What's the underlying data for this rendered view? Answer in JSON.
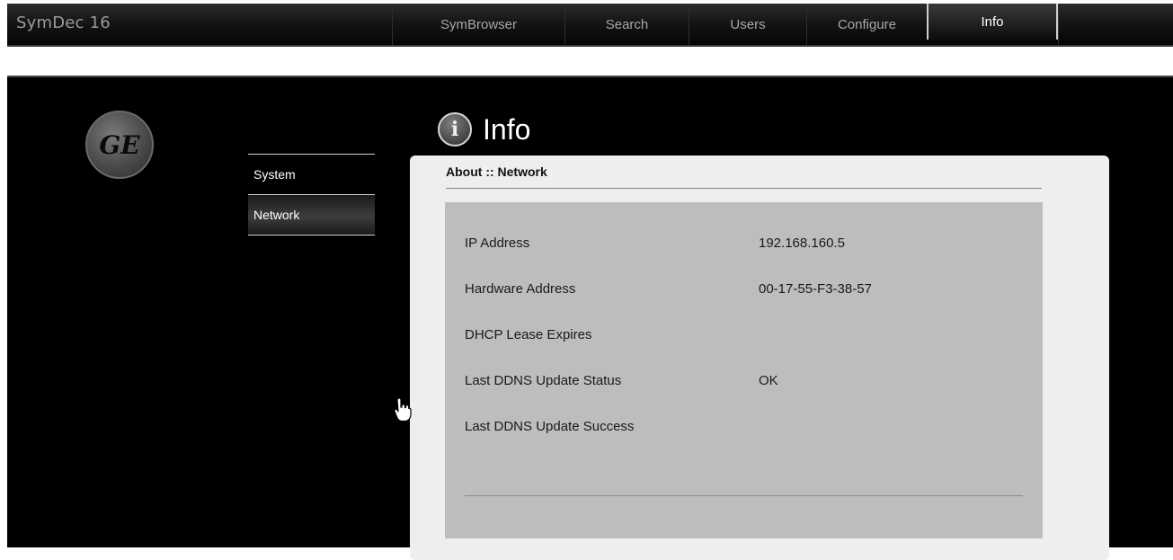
{
  "app": {
    "title": "SymDec 16"
  },
  "nav": {
    "items": [
      {
        "label": "SymBrowser",
        "active": false
      },
      {
        "label": "Search",
        "active": false
      },
      {
        "label": "Users",
        "active": false
      },
      {
        "label": "Configure",
        "active": false
      },
      {
        "label": "Info",
        "active": true
      }
    ]
  },
  "logo": {
    "text": "GE"
  },
  "sidebar": {
    "items": [
      {
        "label": "System",
        "active": false
      },
      {
        "label": "Network",
        "active": true
      }
    ]
  },
  "page": {
    "icon": "info-icon",
    "title": "Info"
  },
  "panel": {
    "header": "About :: Network",
    "rows": [
      {
        "label": "IP Address",
        "value": "192.168.160.5"
      },
      {
        "label": "Hardware Address",
        "value": "00-17-55-F3-38-57"
      },
      {
        "label": "DHCP Lease Expires",
        "value": ""
      },
      {
        "label": "Last DDNS Update Status",
        "value": "OK"
      },
      {
        "label": "Last DDNS Update Success",
        "value": ""
      }
    ]
  },
  "colors": {
    "background": "#000000",
    "panel_bg": "#eeeeee",
    "panel_body_bg": "#bdbdbd",
    "nav_text": "#a7a7a7",
    "nav_active_text": "#ffffff"
  }
}
